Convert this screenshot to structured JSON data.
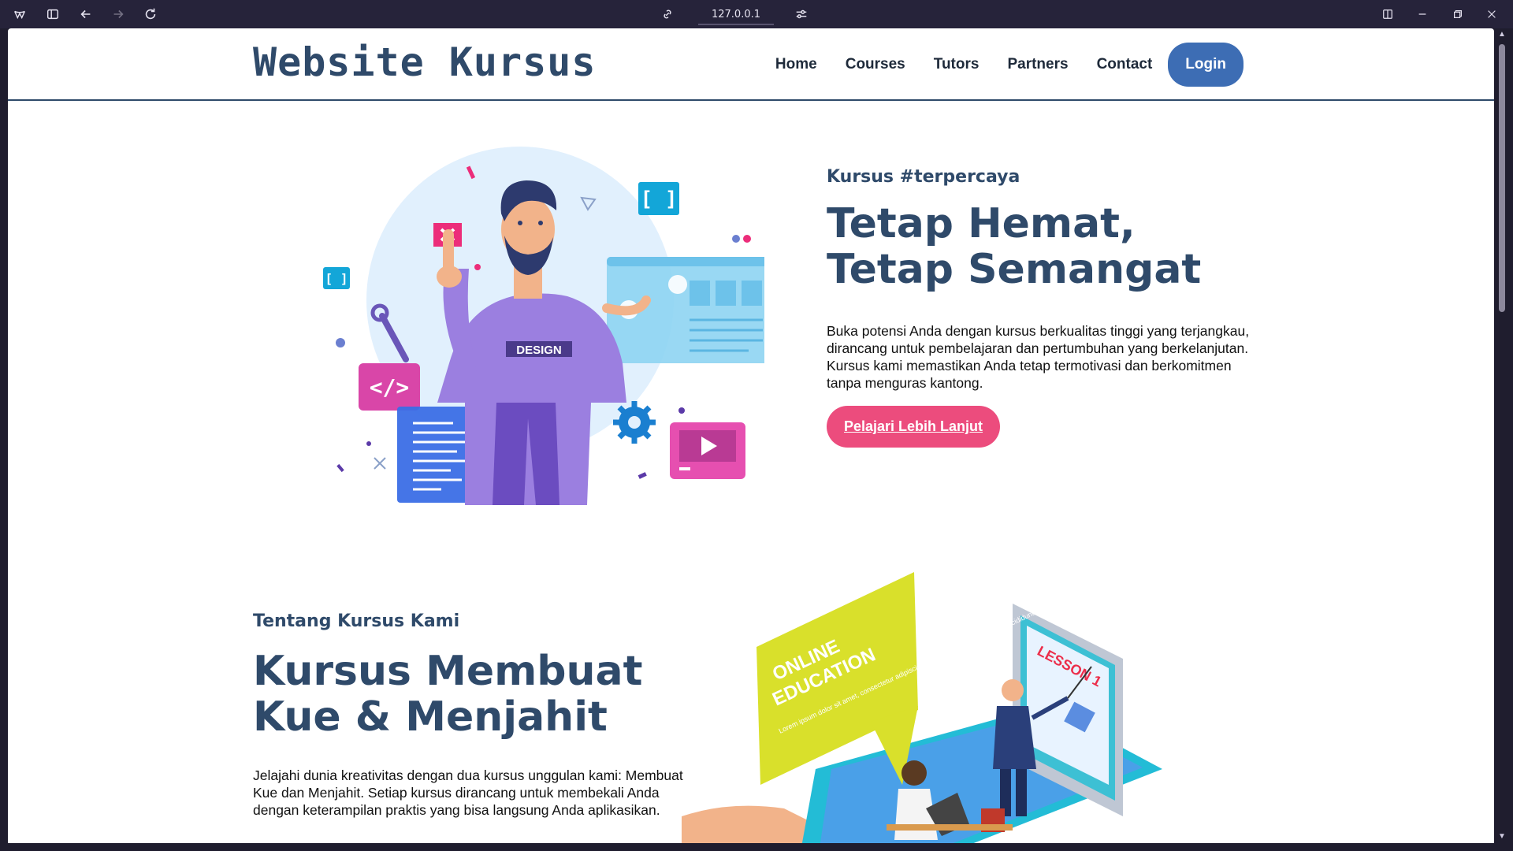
{
  "browser": {
    "url": "127.0.0.1"
  },
  "site": {
    "logo": "Website Kursus",
    "nav": [
      "Home",
      "Courses",
      "Tutors",
      "Partners",
      "Contact"
    ],
    "login": "Login"
  },
  "hero": {
    "kicker": "Kursus #terpercaya",
    "title": "Tetap Hemat, Tetap Semangat",
    "description": "Buka potensi Anda dengan kursus berkualitas tinggi yang terjangkau, dirancang untuk pembelajaran dan pertumbuhan yang berkelanjutan. Kursus kami memastikan Anda tetap termotivasi dan berkomitmen tanpa menguras kantong.",
    "cta": "Pelajari Lebih Lanjut",
    "shirt_text": "DESIGN"
  },
  "about": {
    "kicker": "Tentang Kursus Kami",
    "title": "Kursus Membuat Kue & Menjahit",
    "description": "Jelajahi dunia kreativitas dengan dua kursus unggulan kami: Membuat Kue dan Menjahit. Setiap kursus dirancang untuk membekali Anda dengan keterampilan praktis yang bisa langsung Anda aplikasikan.",
    "bubble_title_1": "ONLINE",
    "bubble_title_2": "EDUCATION",
    "bubble_body": "Lorem ipsum dolor sit amet, consectetur adipiscing elit, sed do eiusmod tempor incididunt ut labore et dolore magna.",
    "screen_label": "LESSON 1"
  },
  "colors": {
    "brand": "#2f4a6a",
    "login": "#3d6db4",
    "cta": "#ec4c7d"
  }
}
